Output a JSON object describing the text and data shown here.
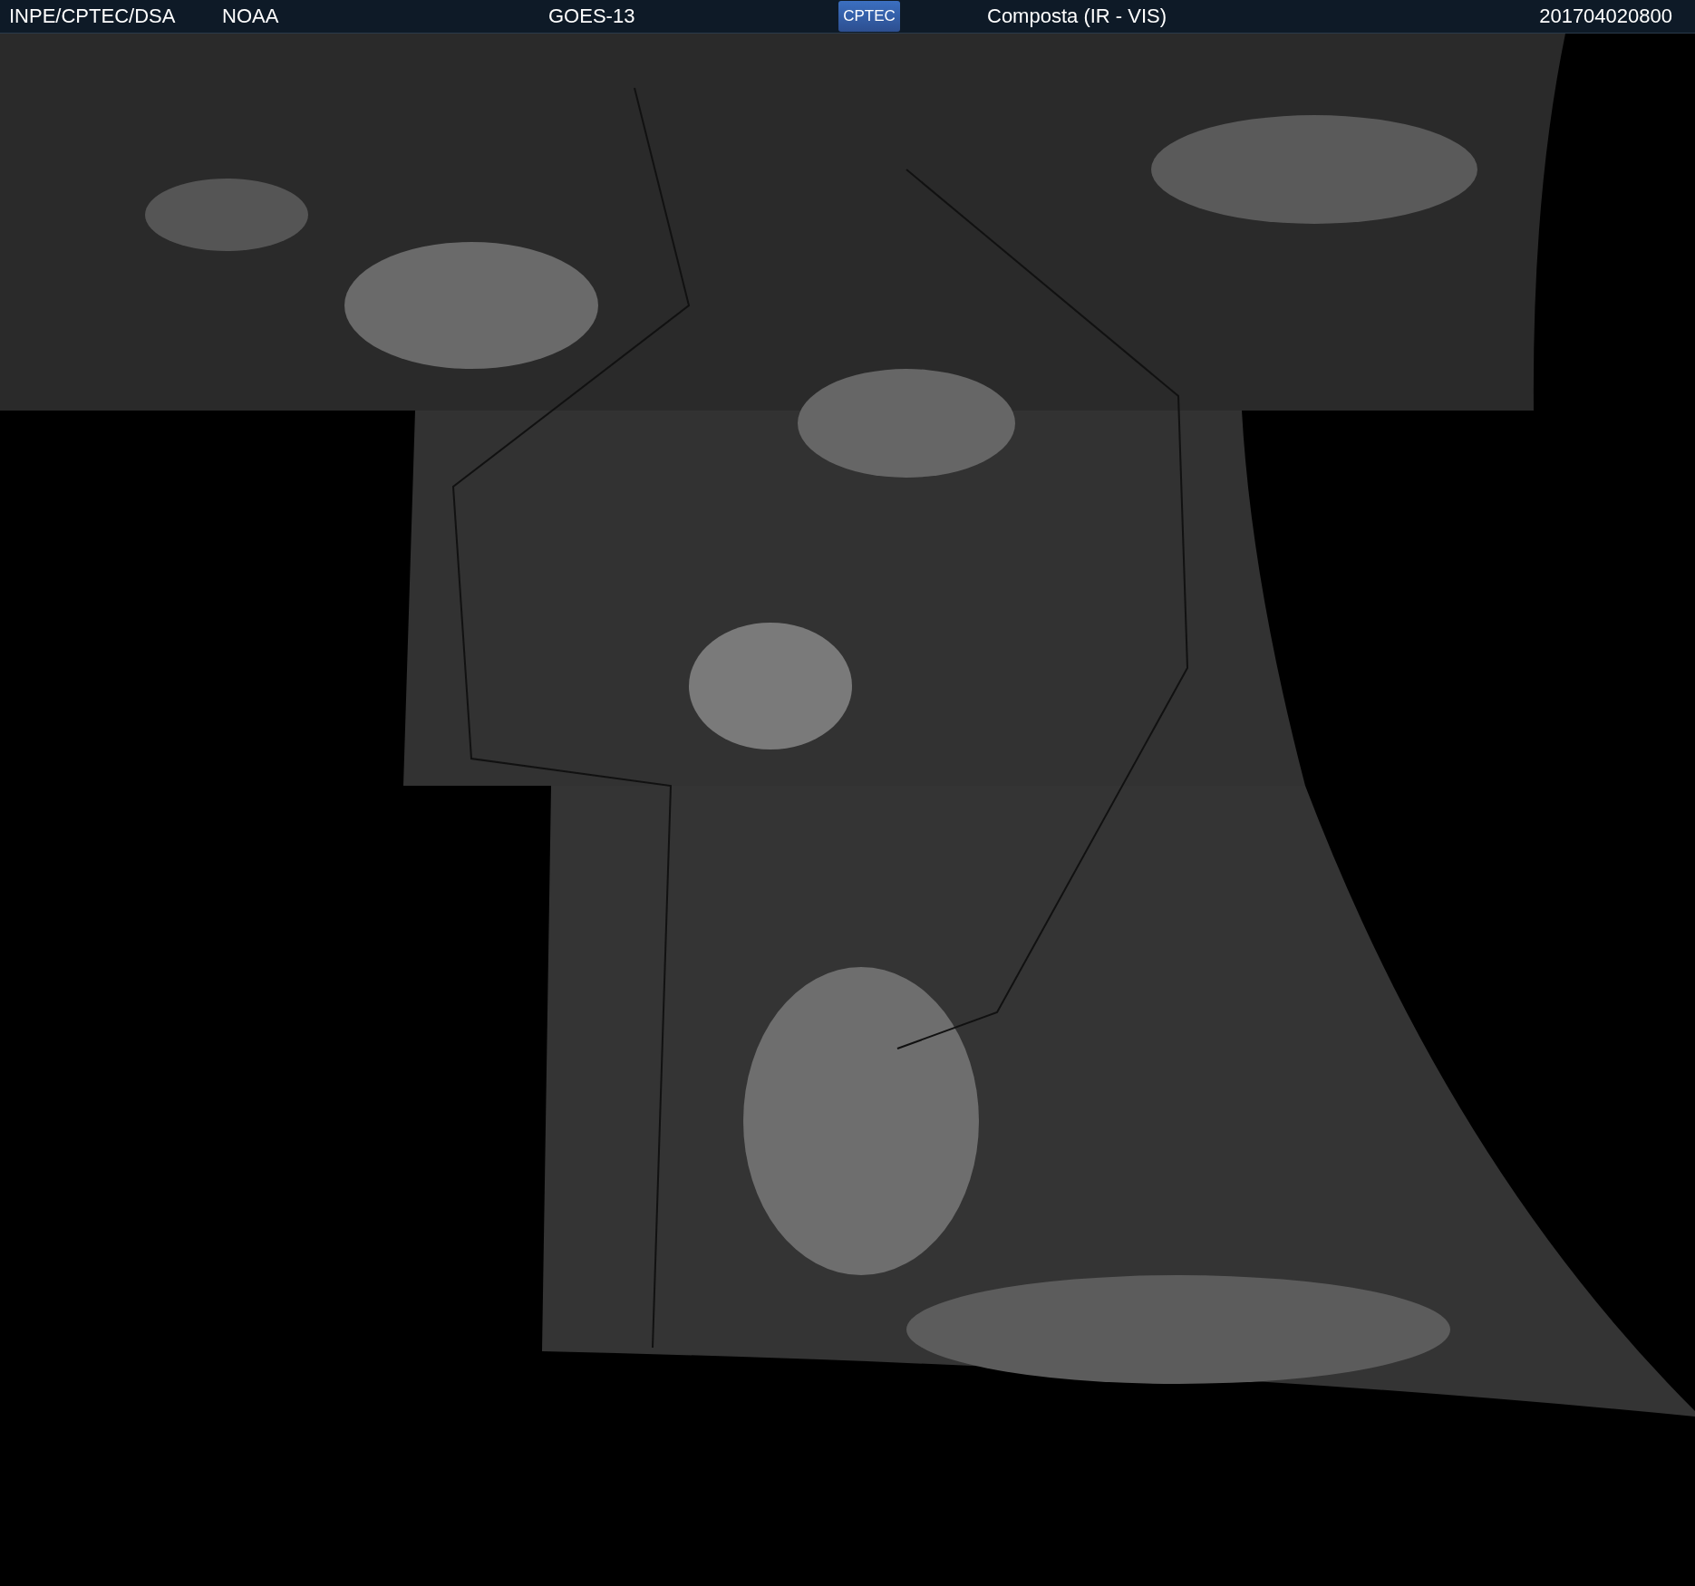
{
  "header": {
    "agency": "INPE/CPTEC/DSA",
    "source": "NOAA",
    "satellite": "GOES-13",
    "logo": "CPTEC",
    "product": "Composta (IR - VIS)",
    "timestamp": "201704020800"
  }
}
